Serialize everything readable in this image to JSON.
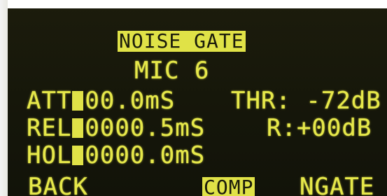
{
  "screen": {
    "title": "NOISE GATE",
    "channel": "MIC 6",
    "attack": {
      "label": "ATT",
      "value": "00.0mS"
    },
    "release": {
      "label": "REL",
      "value": "0000.5mS"
    },
    "hold": {
      "label": "HOL",
      "value": "0000.0mS"
    },
    "threshold": {
      "label": "THR:",
      "value": "-72dB"
    },
    "ratio": {
      "label": "R:",
      "value": "+00dB"
    },
    "softkeys": {
      "back": "BACK",
      "comp": "COMP",
      "ngate": "NGATE"
    }
  },
  "colors": {
    "text": "#e6e84a",
    "background": "#15160a"
  }
}
